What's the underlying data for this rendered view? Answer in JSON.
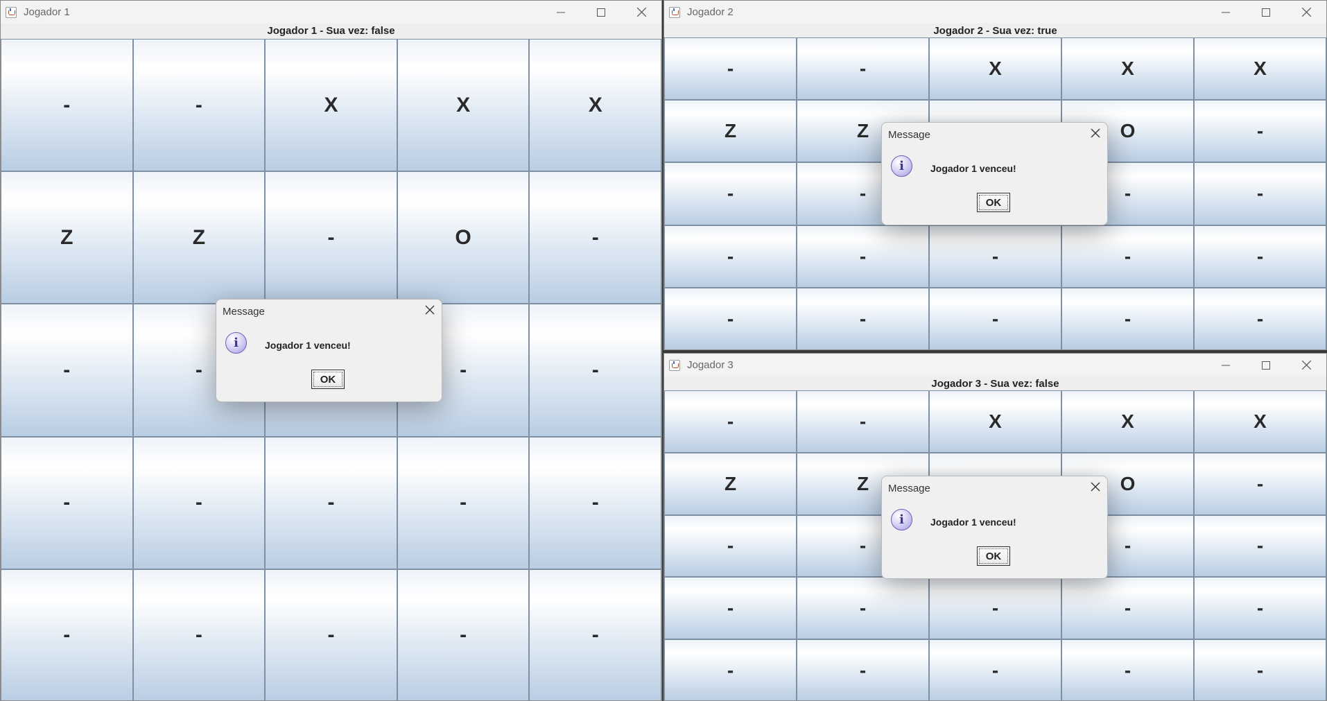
{
  "windows": [
    {
      "title": "Jogador 1",
      "status": "Jogador 1 - Sua vez: false",
      "cells": [
        "-",
        "-",
        "X",
        "X",
        "X",
        "Z",
        "Z",
        "-",
        "O",
        "-",
        "-",
        "-",
        "-",
        "-",
        "-",
        "-",
        "-",
        "-",
        "-",
        "-",
        "-",
        "-",
        "-",
        "-",
        "-"
      ]
    },
    {
      "title": "Jogador 2",
      "status": "Jogador 2 - Sua vez: true",
      "cells": [
        "-",
        "-",
        "X",
        "X",
        "X",
        "Z",
        "Z",
        "-",
        "O",
        "-",
        "-",
        "-",
        "-",
        "-",
        "-",
        "-",
        "-",
        "-",
        "-",
        "-",
        "-",
        "-",
        "-",
        "-",
        "-"
      ]
    },
    {
      "title": "Jogador 3",
      "status": "Jogador 3 - Sua vez: false",
      "cells": [
        "-",
        "-",
        "X",
        "X",
        "X",
        "Z",
        "Z",
        "-",
        "O",
        "-",
        "-",
        "-",
        "-",
        "-",
        "-",
        "-",
        "-",
        "-",
        "-",
        "-",
        "-",
        "-",
        "-",
        "-",
        "-"
      ]
    }
  ],
  "dialog": {
    "title": "Message",
    "message": "Jogador 1 venceu!",
    "ok_label": "OK",
    "info_glyph": "i"
  },
  "window_controls": {
    "minimize": "minimize-icon",
    "maximize": "maximize-icon",
    "close": "close-icon"
  }
}
